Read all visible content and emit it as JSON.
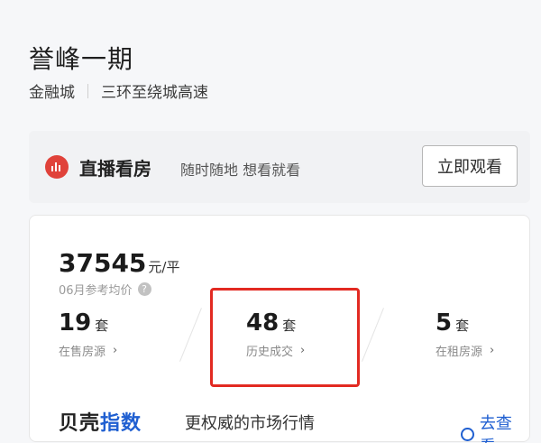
{
  "header": {
    "title": "誉峰一期",
    "area": "金融城",
    "ring": "三环至绕城高速"
  },
  "live": {
    "icon": "live-bars-icon",
    "title": "直播看房",
    "subtitle": "随时随地 想看就看",
    "button_label": "立即观看"
  },
  "stats_card": {
    "price_value": "37545",
    "price_unit": "元/平",
    "price_label": "06月参考均价",
    "help_icon_glyph": "?",
    "stats": [
      {
        "value": "19",
        "unit": "套",
        "label": "在售房源"
      },
      {
        "value": "48",
        "unit": "套",
        "label": "历史成交"
      },
      {
        "value": "5",
        "unit": "套",
        "label": "在租房源"
      }
    ],
    "chevron": "›",
    "highlight_color": "#e22a22"
  },
  "bottom": {
    "brand_prefix": "贝壳",
    "brand_highlight": "指数",
    "description": "更权威的市场行情",
    "more_label": "去查看"
  },
  "colors": {
    "accent_red": "#e0423a",
    "link_blue": "#1f5fd1"
  }
}
